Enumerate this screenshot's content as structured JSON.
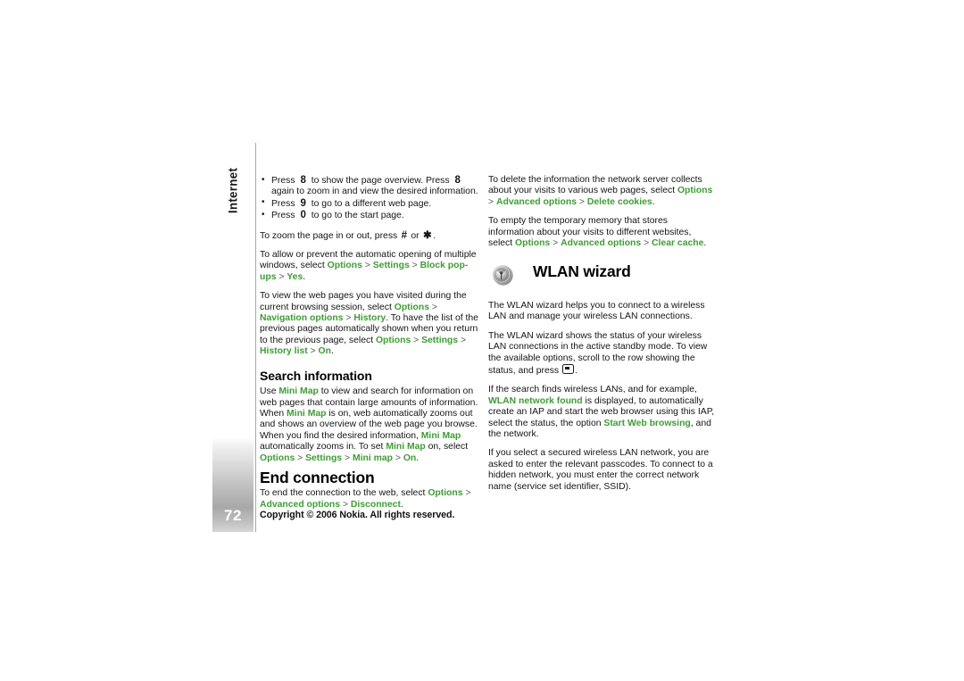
{
  "page": {
    "number": "72",
    "chapter": "Internet",
    "copyright": "Copyright © 2006 Nokia. All rights reserved."
  },
  "colors": {
    "ui_green": "#3f9c35",
    "text": "#151515",
    "rule": "#a6a6a6"
  },
  "left_column": {
    "bullets": [
      {
        "pre": "Press",
        "key": "8",
        "mid": "to show the page overview. Press",
        "key2": "8",
        "post": "again to zoom in and view the desired information."
      },
      {
        "pre": "Press",
        "key": "9",
        "mid": "to go to a different web page.",
        "key2": "",
        "post": ""
      },
      {
        "pre": "Press",
        "key": "0",
        "mid": "to go to the start page.",
        "key2": "",
        "post": ""
      }
    ],
    "zoom_para": {
      "pre": "To zoom the page in or out, press",
      "key1": "#",
      "mid": "or",
      "key2": "✱",
      "post": "."
    },
    "popups_para": {
      "t1": "To allow or prevent the automatic opening of multiple windows, select ",
      "u1": "Options",
      "s1": " > ",
      "u2": "Settings",
      "s2": " > ",
      "u3": "Block pop-ups",
      "s3": " > ",
      "u4": "Yes",
      "t2": "."
    },
    "history_para": {
      "t1": "To view the web pages you have visited during the current browsing session, select ",
      "u1": "Options",
      "s1": " > ",
      "u2": "Navigation options",
      "s2": " > ",
      "u3": "History",
      "t2": ". To have the list of the previous pages automatically shown when you return to the previous page, select ",
      "u4": "Options",
      "s3": " > ",
      "u5": "Settings",
      "s4": " > ",
      "u6": "History list",
      "s5": " > ",
      "u7": "On",
      "t3": "."
    },
    "search_heading": "Search information",
    "search_para": {
      "t1": "Use ",
      "u1": "Mini Map",
      "t2": " to view and search for information on web pages that contain large amounts of information. When ",
      "u2": "Mini Map",
      "t3": " is on, web automatically zooms out and shows an overview of the web page you browse. When you find the desired information, ",
      "u3": "Mini Map",
      "t4": " automatically zooms in. To set ",
      "u4": "Mini Map",
      "t5": " on, select ",
      "u5": "Options",
      "s1": " > ",
      "u6": "Settings",
      "s2": " > ",
      "u7": "Mini map",
      "s3": " > ",
      "u8": "On",
      "t6": "."
    },
    "end_heading": "End connection",
    "end_para": {
      "t1": "To end the connection to the web, select ",
      "u1": "Options",
      "s1": " > ",
      "u2": "Advanced options",
      "s2": " > ",
      "u3": "Disconnect",
      "t2": "."
    }
  },
  "right_column": {
    "cookies_para": {
      "t1": "To delete the information the network server collects about your visits to various web pages, select ",
      "u1": "Options",
      "s1": " > ",
      "u2": "Advanced options",
      "s2": " > ",
      "u3": "Delete cookies",
      "t2": "."
    },
    "cache_para": {
      "t1": "To empty the temporary memory that stores information about your visits to different websites, select ",
      "u1": "Options",
      "s1": " > ",
      "u2": "Advanced options",
      "s2": " > ",
      "u3": "Clear cache",
      "t2": "."
    },
    "wlan_title": "WLAN wizard",
    "wlan_icon_name": "wlan-wizard-icon",
    "wlan_intro": "The WLAN wizard helps you to connect to a wireless LAN and manage your wireless LAN connections.",
    "wlan_status": {
      "t1": "The WLAN wizard shows the status of your wireless LAN connections in the active standby mode. To view the available options, scroll to the row showing the status, and press ",
      "t2": "."
    },
    "wlan_found_para": {
      "t1": "If the search finds wireless LANs, and for example, ",
      "u1": "WLAN network found",
      "t2": " is displayed, to automatically create an IAP and start the web browser using this IAP, select the status, the option ",
      "u2": "Start Web browsing",
      "t3": ", and the network."
    },
    "wlan_secured_para": "If you select a secured wireless LAN network, you are asked to enter the relevant passcodes. To connect to a hidden network, you must enter the correct network name (service set identifier, SSID)."
  }
}
